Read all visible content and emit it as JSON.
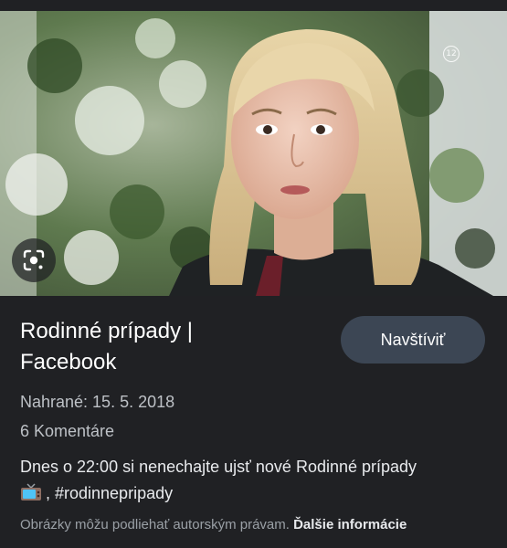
{
  "result": {
    "title_line1": "Rodinné prípady |",
    "title_line2": "Facebook",
    "visit_label": "Navštíviť",
    "uploaded": "Nahrané: 15. 5. 2018",
    "comments": "6 Komentáre",
    "description_line1": "Dnes o 22:00 si nenechajte ujsť nové Rodinné prípady",
    "description_line2": ", #rodinnepripady",
    "description_emoji_icon": "tv-icon",
    "footer_text": "Obrázky môžu podliehať autorským právam.",
    "footer_link": "Ďalšie informácie"
  },
  "image": {
    "rating_badge": "12",
    "lens_icon": "google-lens-icon"
  },
  "colors": {
    "background": "#202124",
    "button": "#3c4654",
    "muted_text": "#bdc1c6",
    "footer_text": "#9aa0a6"
  }
}
